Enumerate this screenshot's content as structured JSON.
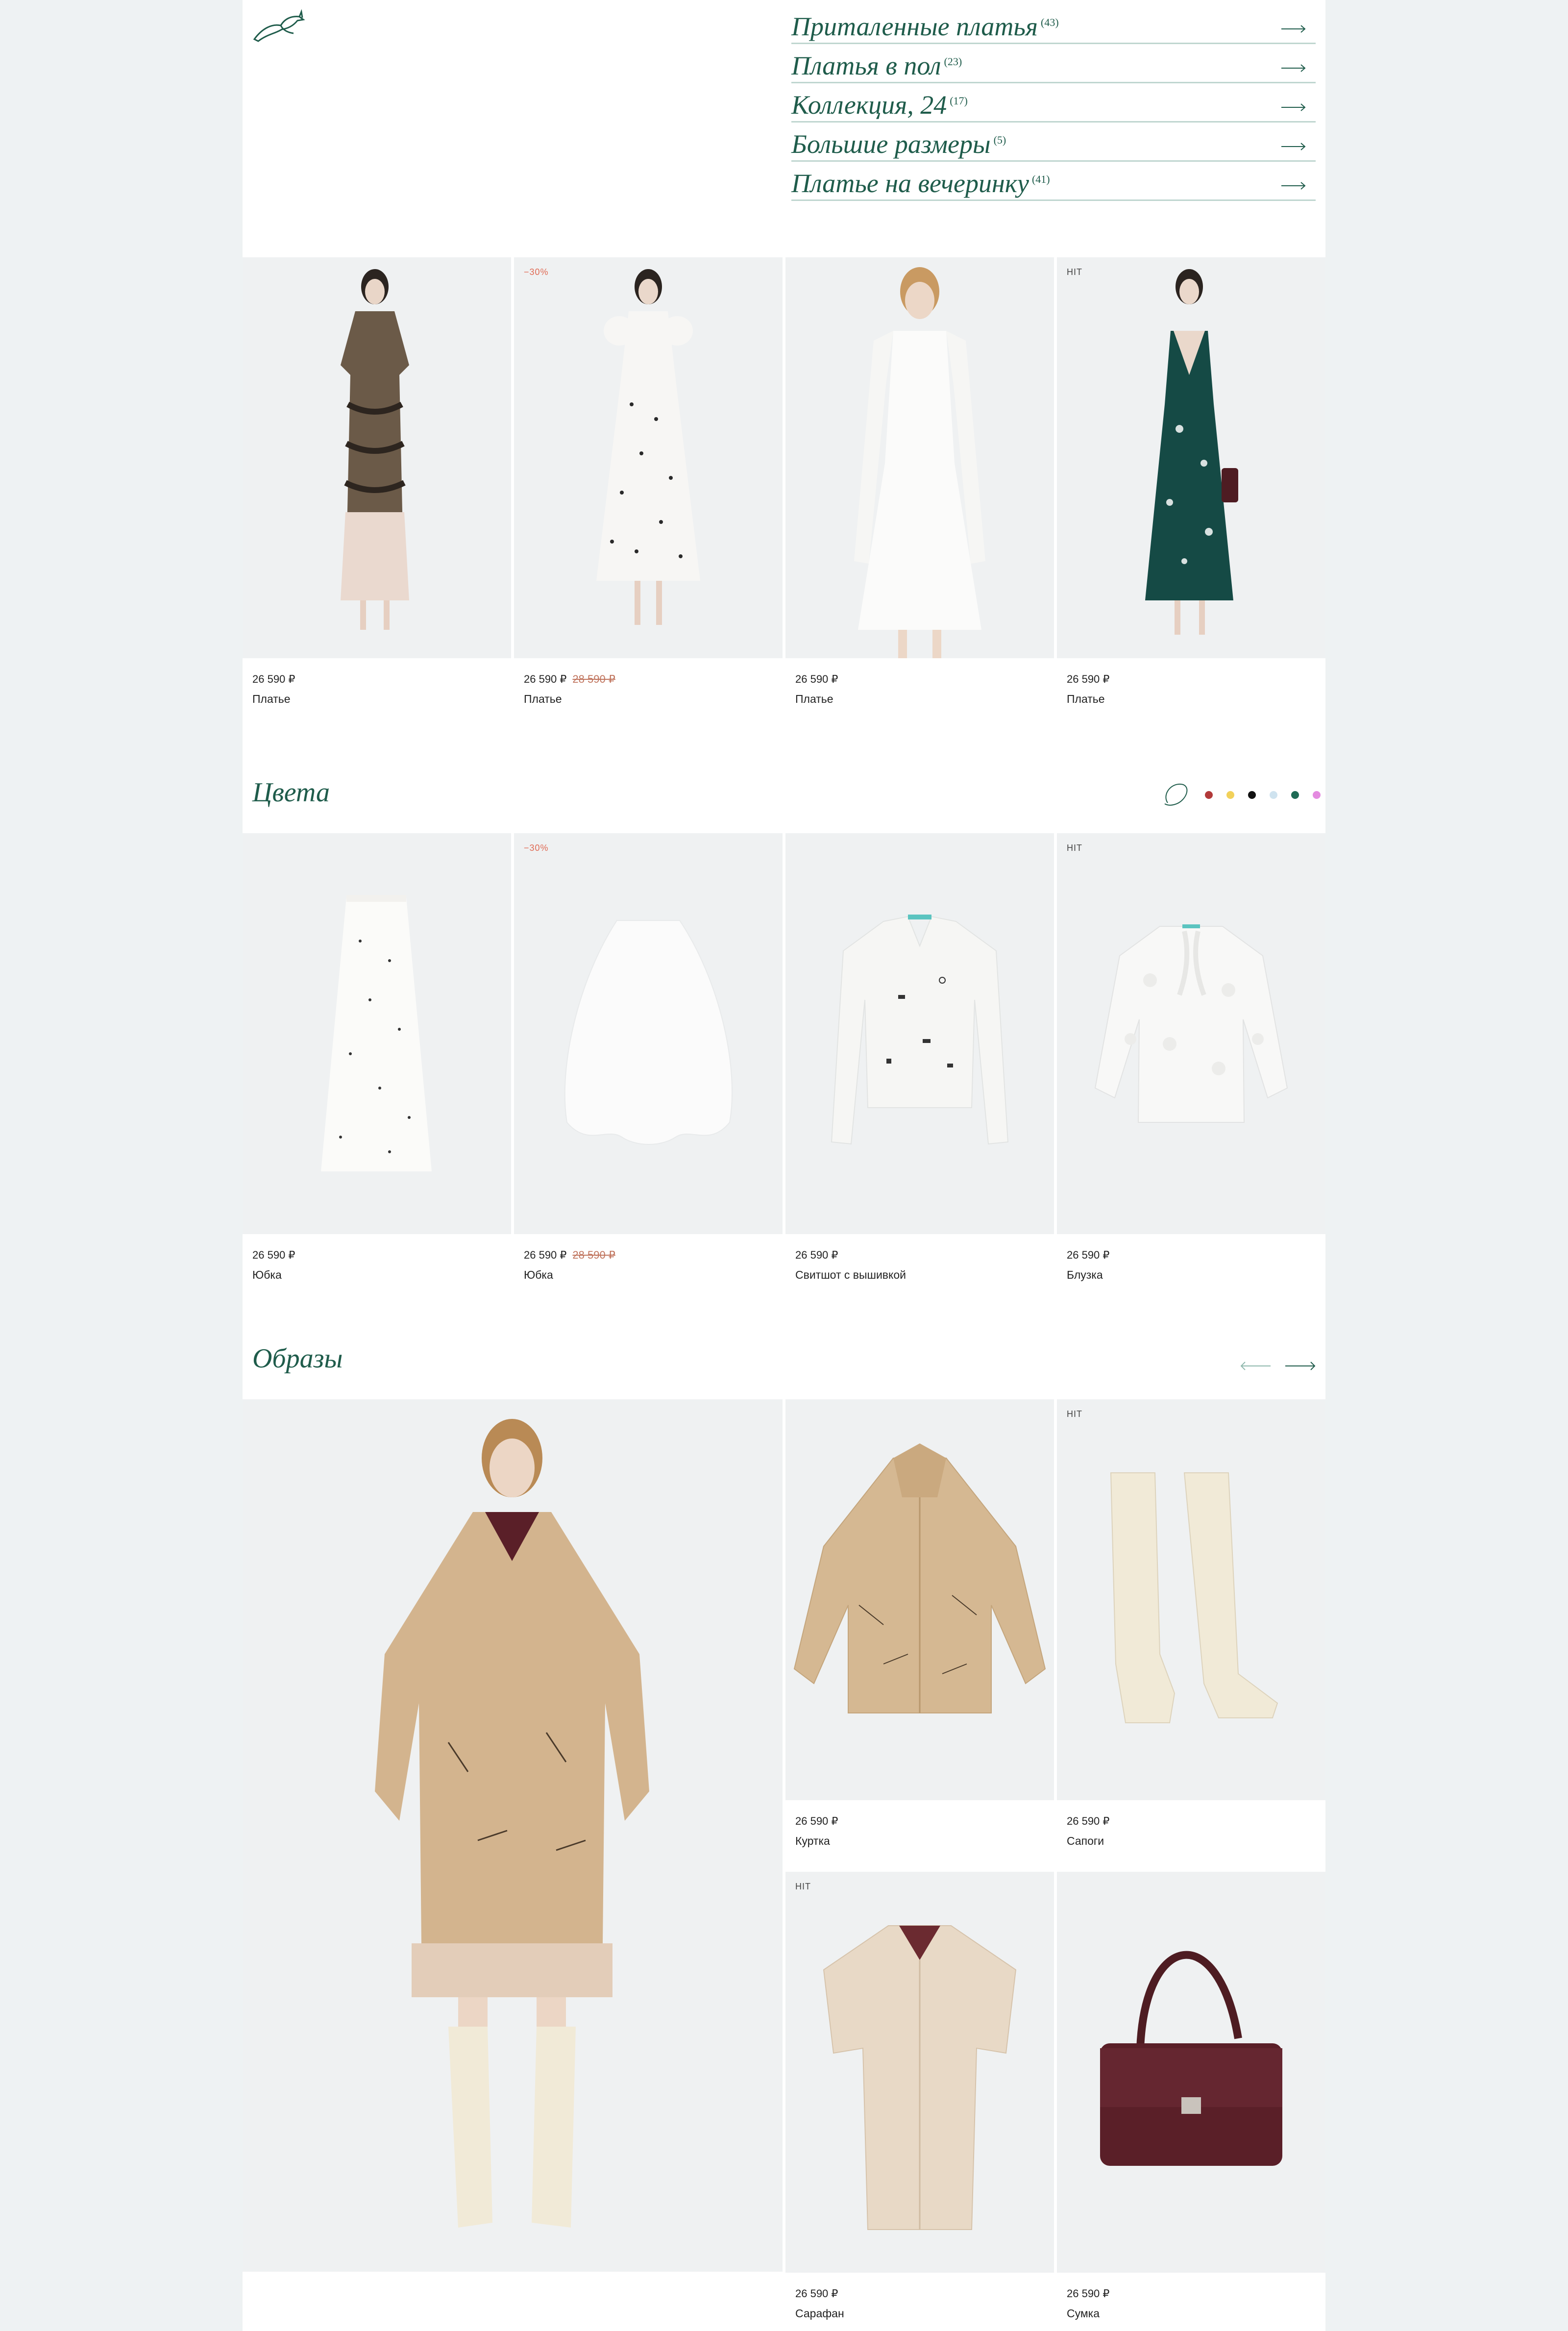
{
  "categories": [
    {
      "title": "Приталенные платья",
      "count": "(43)"
    },
    {
      "title": "Платья в пол",
      "count": "(23)"
    },
    {
      "title": "Коллекция, 24",
      "count": "(17)"
    },
    {
      "title": "Большие размеры",
      "count": "(5)"
    },
    {
      "title": "Платье на вечеринку",
      "count": "(41)"
    }
  ],
  "row1": [
    {
      "badge": "",
      "price": "26 590 ₽",
      "old_price": "",
      "name": "Платье"
    },
    {
      "badge": "−30%",
      "price": "26 590 ₽",
      "old_price": "28 590 ₽",
      "name": "Платье"
    },
    {
      "badge": "",
      "price": "26 590 ₽",
      "old_price": "",
      "name": "Платье"
    },
    {
      "badge": "HIT",
      "price": "26 590 ₽",
      "old_price": "",
      "name": "Платье"
    }
  ],
  "colors_section": {
    "title": "Цвета",
    "swatches": [
      "#b23a3a",
      "#f2d15a",
      "#111111",
      "#cfe3ef",
      "#1f6b55",
      "#e48be0"
    ]
  },
  "row2": [
    {
      "badge": "",
      "price": "26 590 ₽",
      "old_price": "",
      "name": "Юбка"
    },
    {
      "badge": "−30%",
      "price": "26 590 ₽",
      "old_price": "28 590 ₽",
      "name": "Юбка"
    },
    {
      "badge": "",
      "price": "26 590 ₽",
      "old_price": "",
      "name": "Свитшот с вышивкой"
    },
    {
      "badge": "HIT",
      "price": "26 590 ₽",
      "old_price": "",
      "name": "Блузка"
    }
  ],
  "looks_section": {
    "title": "Образы"
  },
  "looks": [
    {
      "badge": "",
      "price": "26 590 ₽",
      "name": "Куртка"
    },
    {
      "badge": "HIT",
      "price": "26 590 ₽",
      "name": "Сапоги"
    },
    {
      "badge": "HIT",
      "price": "26 590 ₽",
      "name": "Сарафан"
    },
    {
      "badge": "",
      "price": "26 590 ₽",
      "name": "Сумка"
    }
  ]
}
